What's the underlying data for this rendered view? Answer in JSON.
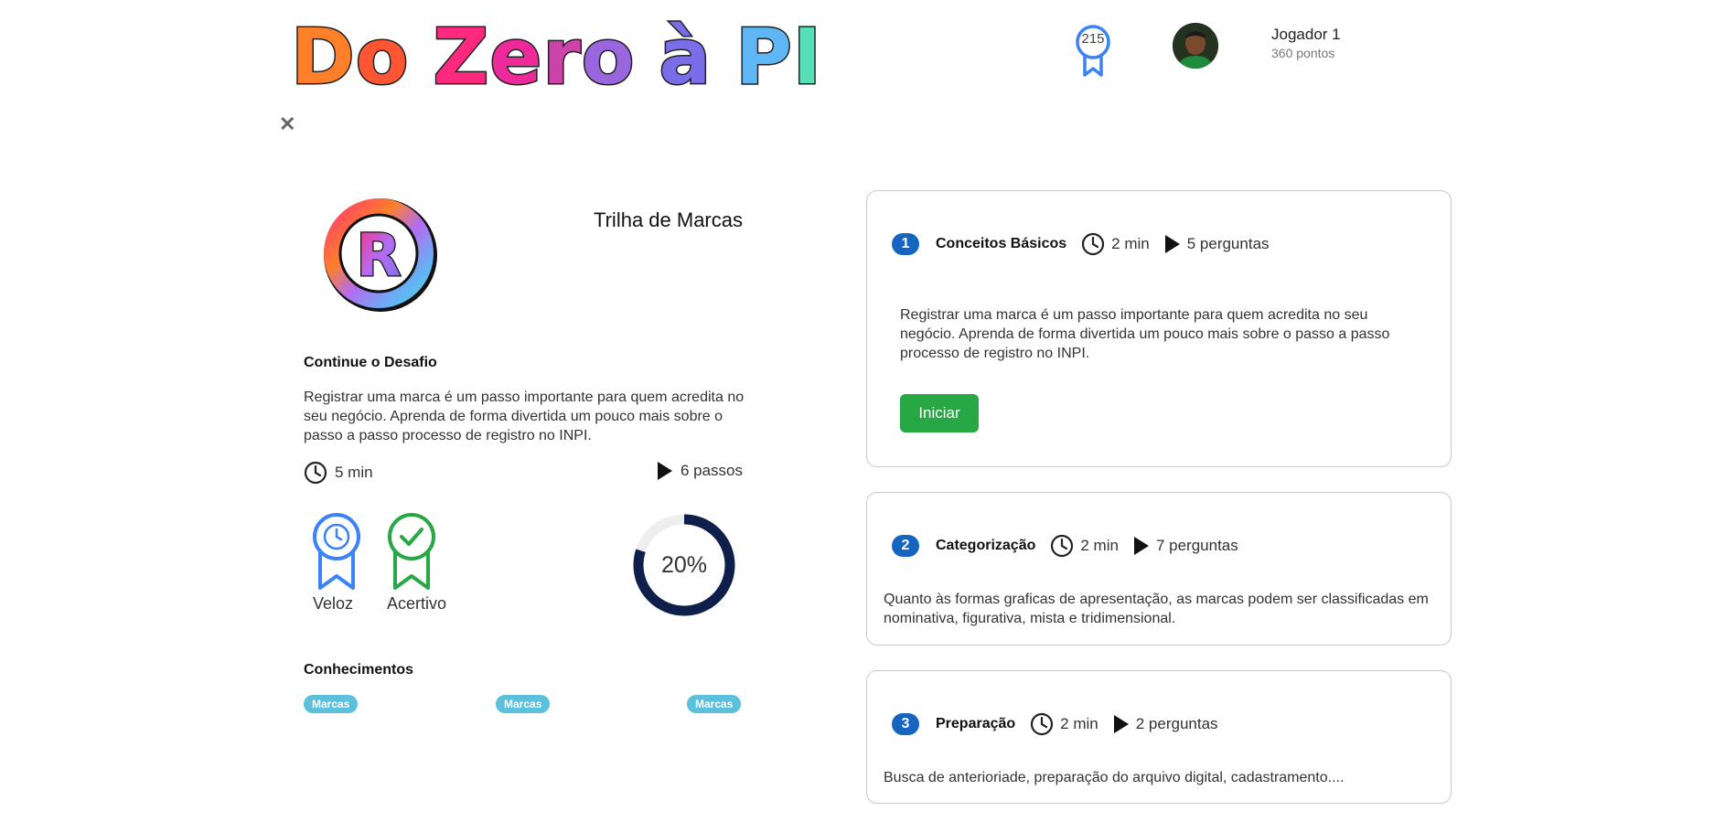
{
  "header": {
    "logo_letters": [
      {
        "char": "D",
        "color": "#ff7f2a"
      },
      {
        "char": "o",
        "color": "#ff5533"
      },
      {
        "char": " ",
        "color": "#ffffff"
      },
      {
        "char": "Z",
        "color": "#ff2a7f"
      },
      {
        "char": "e",
        "color": "#ee2a9a"
      },
      {
        "char": "r",
        "color": "#cc44aa"
      },
      {
        "char": "o",
        "color": "#9966dd"
      },
      {
        "char": " ",
        "color": "#ffffff"
      },
      {
        "char": "à",
        "color": "#7a6ee8"
      },
      {
        "char": " ",
        "color": "#ffffff"
      },
      {
        "char": "P",
        "color": "#5fb6f5"
      },
      {
        "char": "I",
        "color": "#55e0b8"
      }
    ],
    "badge_count": "215",
    "player_name": "Jogador 1",
    "player_points": "360 pontos"
  },
  "trail": {
    "title": "Trilha de Marcas",
    "continue_heading": "Continue o Desafio",
    "description": "Registrar uma marca é um passo importante para quem acredita no seu negócio. Aprenda de forma divertida um pouco mais sobre o passo a passo processo de registro no INPI.",
    "duration": "5 min",
    "steps": "6 passos",
    "medals": [
      {
        "label": "Veloz",
        "icon": "clock-medal-icon",
        "color": "#3b82f6"
      },
      {
        "label": "Acertivo",
        "icon": "check-medal-icon",
        "color": "#28a745"
      }
    ],
    "progress": 20,
    "progress_label": "20%",
    "knowledge_heading": "Conhecimentos",
    "tags": [
      "Marcas",
      "Marcas",
      "Marcas"
    ]
  },
  "steps": [
    {
      "number": "1",
      "title": "Conceitos Básicos",
      "duration": "2 min",
      "questions": "5 perguntas",
      "description": "Registrar uma marca é um passo importante para quem acredita no seu negócio. Aprenda de forma divertida um pouco mais sobre o passo a passo processo de registro no INPI.",
      "button": "Iniciar"
    },
    {
      "number": "2",
      "title": "Categorização",
      "duration": "2 min",
      "questions": "7 perguntas",
      "description": "Quanto às formas graficas de apresentação, as marcas podem ser classificadas em nominativa, figurativa, mista e tridimensional."
    },
    {
      "number": "3",
      "title": "Preparação",
      "duration": "2 min",
      "questions": "2 perguntas",
      "description": "Busca de anterioriade, preparação do arquivo digital, cadastramento...."
    }
  ],
  "colors": {
    "accent_blue": "#1565c0",
    "success_green": "#28a745",
    "tag_cyan": "#5bc0de",
    "progress_navy": "#0d1f4a"
  }
}
